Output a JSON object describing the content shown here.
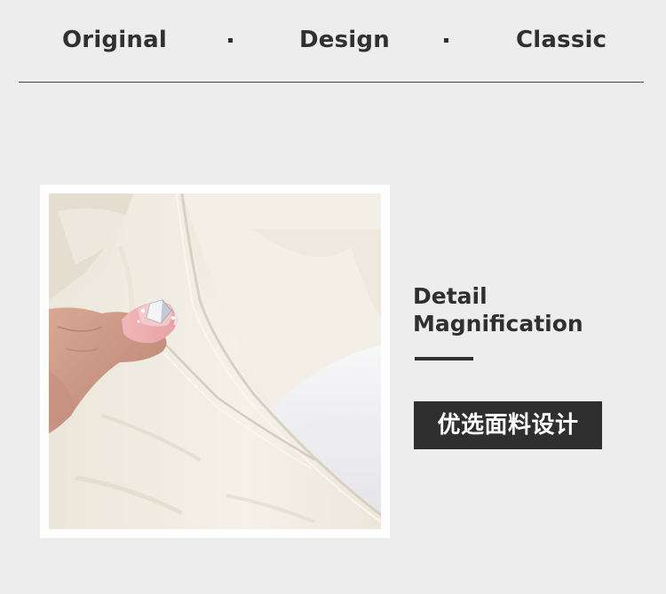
{
  "nav": {
    "items": [
      "Original",
      "Design",
      "Classic"
    ]
  },
  "detail": {
    "line1": "Detail",
    "line2": "Magnification"
  },
  "badge": {
    "label": "优选面料设计"
  },
  "colors": {
    "background": "#ededed",
    "text": "#2f2f2f",
    "badge_bg": "#2f2f2f",
    "badge_text": "#ffffff",
    "leather": "#f1ece2"
  },
  "image": {
    "subject": "close-up of cream leather bag with hand"
  }
}
